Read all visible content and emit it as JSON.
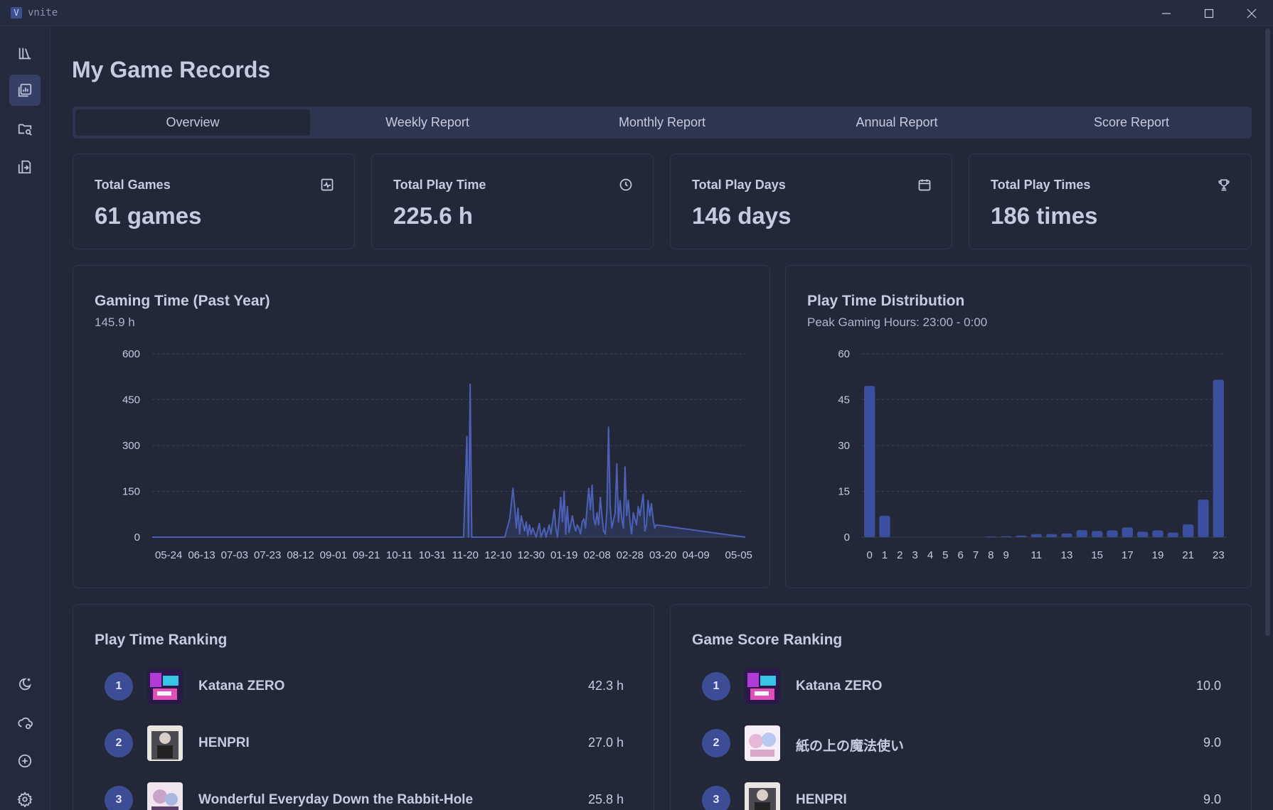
{
  "app": {
    "logo_letter": "V",
    "title": "vnite"
  },
  "page": {
    "title": "My Game Records"
  },
  "tabs": [
    "Overview",
    "Weekly Report",
    "Monthly Report",
    "Annual Report",
    "Score Report"
  ],
  "active_tab": "Overview",
  "stats": [
    {
      "label": "Total Games",
      "value": "61 games",
      "icon": "activity-icon"
    },
    {
      "label": "Total Play Time",
      "value": "225.6 h",
      "icon": "clock-icon"
    },
    {
      "label": "Total Play Days",
      "value": "146 days",
      "icon": "calendar-icon"
    },
    {
      "label": "Total Play Times",
      "value": "186 times",
      "icon": "trophy-icon"
    }
  ],
  "gaming_time": {
    "title": "Gaming Time (Past Year)",
    "subtitle": "145.9 h"
  },
  "distribution": {
    "title": "Play Time Distribution",
    "subtitle": "Peak Gaming Hours: 23:00 - 0:00"
  },
  "chart_data": [
    {
      "type": "area",
      "title": "Gaming Time (Past Year)",
      "ylim": [
        0,
        600
      ],
      "yticks": [
        0,
        150,
        300,
        450,
        600
      ],
      "xticks": [
        "05-24",
        "06-13",
        "07-03",
        "07-23",
        "08-12",
        "09-01",
        "09-21",
        "10-11",
        "10-31",
        "11-20",
        "12-10",
        "12-30",
        "01-19",
        "02-08",
        "02-28",
        "03-20",
        "04-09",
        "05-05"
      ],
      "x_range": [
        "05-14",
        "05-09"
      ],
      "points": [
        [
          "05-14",
          0
        ],
        [
          "11-19",
          0
        ],
        [
          "11-21",
          330
        ],
        [
          "11-22",
          0
        ],
        [
          "11-23",
          500
        ],
        [
          "11-24",
          0
        ],
        [
          "12-14",
          0
        ],
        [
          "12-15",
          20
        ],
        [
          "12-17",
          60
        ],
        [
          "12-19",
          160
        ],
        [
          "12-20",
          100
        ],
        [
          "12-21",
          30
        ],
        [
          "12-22",
          95
        ],
        [
          "12-23",
          10
        ],
        [
          "12-24",
          70
        ],
        [
          "12-26",
          20
        ],
        [
          "12-27",
          50
        ],
        [
          "12-28",
          5
        ],
        [
          "12-29",
          40
        ],
        [
          "12-30",
          10
        ],
        [
          "12-31",
          30
        ],
        [
          "01-02",
          0
        ],
        [
          "01-04",
          45
        ],
        [
          "01-05",
          0
        ],
        [
          "01-07",
          30
        ],
        [
          "01-08",
          0
        ],
        [
          "01-10",
          40
        ],
        [
          "01-11",
          10
        ],
        [
          "01-13",
          90
        ],
        [
          "01-14",
          30
        ],
        [
          "01-15",
          0
        ],
        [
          "01-16",
          60
        ],
        [
          "01-17",
          130
        ],
        [
          "01-18",
          50
        ],
        [
          "01-19",
          150
        ],
        [
          "01-20",
          10
        ],
        [
          "01-21",
          100
        ],
        [
          "01-22",
          15
        ],
        [
          "01-24",
          70
        ],
        [
          "01-25",
          40
        ],
        [
          "01-26",
          20
        ],
        [
          "01-27",
          40
        ],
        [
          "01-28",
          30
        ],
        [
          "01-29",
          10
        ],
        [
          "01-30",
          50
        ],
        [
          "01-31",
          60
        ],
        [
          "02-01",
          30
        ],
        [
          "02-02",
          100
        ],
        [
          "02-03",
          160
        ],
        [
          "02-04",
          90
        ],
        [
          "02-05",
          170
        ],
        [
          "02-06",
          60
        ],
        [
          "02-07",
          40
        ],
        [
          "02-08",
          80
        ],
        [
          "02-09",
          40
        ],
        [
          "02-10",
          130
        ],
        [
          "02-11",
          70
        ],
        [
          "02-12",
          20
        ],
        [
          "02-13",
          10
        ],
        [
          "02-14",
          90
        ],
        [
          "02-15",
          360
        ],
        [
          "02-16",
          100
        ],
        [
          "02-17",
          30
        ],
        [
          "02-19",
          80
        ],
        [
          "02-20",
          240
        ],
        [
          "02-21",
          50
        ],
        [
          "02-22",
          120
        ],
        [
          "02-23",
          60
        ],
        [
          "02-24",
          30
        ],
        [
          "02-25",
          230
        ],
        [
          "02-26",
          70
        ],
        [
          "02-27",
          120
        ],
        [
          "02-28",
          50
        ],
        [
          "03-01",
          10
        ],
        [
          "03-02",
          80
        ],
        [
          "03-03",
          60
        ],
        [
          "03-04",
          40
        ],
        [
          "03-05",
          100
        ],
        [
          "03-06",
          70
        ],
        [
          "03-08",
          140
        ],
        [
          "03-09",
          20
        ],
        [
          "03-10",
          40
        ],
        [
          "03-11",
          120
        ],
        [
          "03-12",
          70
        ],
        [
          "03-13",
          110
        ],
        [
          "03-14",
          60
        ],
        [
          "03-15",
          30
        ],
        [
          "03-16",
          40
        ],
        [
          "05-09",
          0
        ]
      ]
    },
    {
      "type": "bar",
      "title": "Play Time Distribution",
      "ylim": [
        0,
        60
      ],
      "yticks": [
        0,
        15,
        30,
        45,
        60
      ],
      "categories": [
        "0",
        "1",
        "2",
        "3",
        "4",
        "5",
        "6",
        "7",
        "8",
        "9",
        "10",
        "11",
        "12",
        "13",
        "14",
        "15",
        "16",
        "17",
        "18",
        "19",
        "20",
        "21",
        "22",
        "23"
      ],
      "xtick_labels": [
        "0",
        "1",
        "2",
        "3",
        "4",
        "5",
        "6",
        "7",
        "8",
        "9",
        "11",
        "13",
        "15",
        "17",
        "19",
        "21",
        "23"
      ],
      "values": [
        49.5,
        7,
        0,
        0,
        0,
        0,
        0,
        0,
        0.2,
        0.3,
        0.5,
        1,
        1,
        1.2,
        2.3,
        2,
        2.2,
        3.2,
        1.8,
        2.2,
        1.5,
        4.2,
        12.3,
        51.5
      ],
      "color": "#3b4f9f"
    }
  ],
  "play_time_ranking": {
    "title": "Play Time Ranking",
    "items": [
      {
        "rank": "1",
        "name": "Katana ZERO",
        "value": "42.3 h"
      },
      {
        "rank": "2",
        "name": "HENPRI",
        "value": "27.0 h"
      },
      {
        "rank": "3",
        "name": "Wonderful Everyday Down the Rabbit-Hole",
        "value": "25.8 h"
      }
    ]
  },
  "score_ranking": {
    "title": "Game Score Ranking",
    "items": [
      {
        "rank": "1",
        "name": "Katana ZERO",
        "value": "10.0"
      },
      {
        "rank": "2",
        "name": "紙の上の魔法使い",
        "value": "9.0"
      },
      {
        "rank": "3",
        "name": "HENPRI",
        "value": "9.0"
      }
    ]
  },
  "colors": {
    "accent": "#3c4d95",
    "bar": "#3b4f9f",
    "line": "#4c60b8",
    "background": "#232838"
  }
}
